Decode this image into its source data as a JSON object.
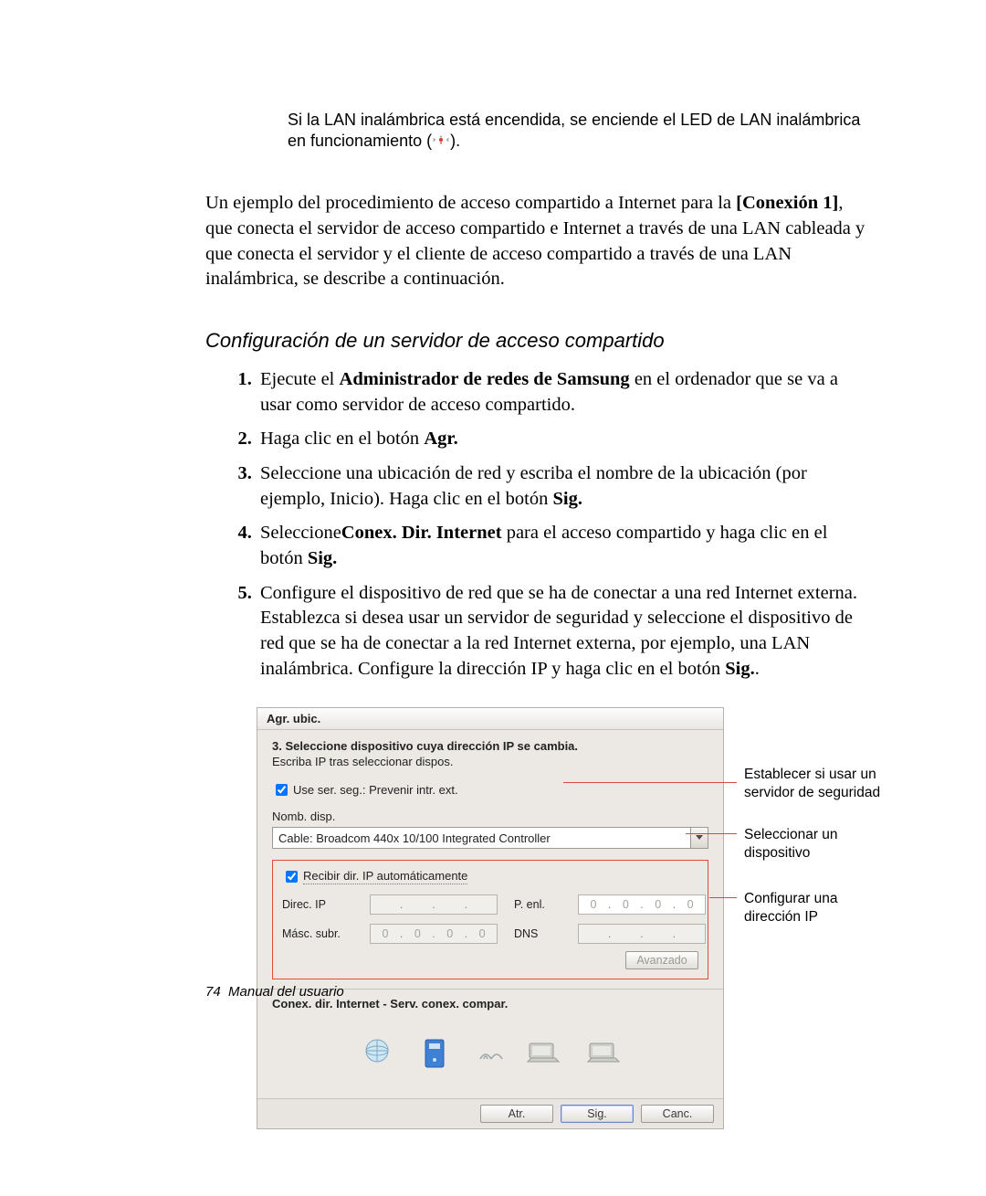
{
  "note": {
    "line1": "Si la LAN inalámbrica está encendida, se enciende el LED de LAN inalámbrica",
    "line2_a": "en funcionamiento (",
    "line2_b": ")."
  },
  "intro": {
    "p1_a": "Un ejemplo del procedimiento de acceso compartido a Internet para la ",
    "p1_b": "[Conexión 1]",
    "p1_c": ", que conecta el servidor de acceso compartido e Internet a través de una LAN cableada y que conecta el servidor y el cliente de acceso compartido a través de una LAN inalámbrica, se describe a continuación."
  },
  "subhead": "Configuración de un servidor de acceso compartido",
  "steps": {
    "s1_a": "Ejecute el ",
    "s1_b": "Administrador de redes de Samsung",
    "s1_c": " en el ordenador que se va a usar como servidor de acceso compartido.",
    "s2_a": "Haga clic en el botón ",
    "s2_b": "Agr.",
    "s3_a": "Seleccione una ubicación de red y escriba el nombre de la ubicación (por ejemplo, Inicio). Haga clic en el botón ",
    "s3_b": "Sig.",
    "s4_a": "Seleccione",
    "s4_b": "Conex. Dir. Internet",
    "s4_c": " para el acceso compartido y haga clic en el botón ",
    "s4_d": "Sig.",
    "s5_a": "Configure el dispositivo de red que se ha de conectar a una red Internet externa. Establezca si desea usar un servidor de seguridad y seleccione el dispositivo de red que se ha de conectar a la red Internet externa, por ejemplo, una LAN inalámbrica. Configure la dirección IP y haga clic en el botón  ",
    "s5_b": "Sig.",
    "s5_c": "."
  },
  "dialog": {
    "title": "Agr. ubic.",
    "subtitle": "3. Seleccione dispositivo cuya dirección IP se cambia.",
    "hint": "Escriba IP tras seleccionar dispos.",
    "chk_security": "Use ser. seg.: Prevenir intr. ext.",
    "device_label": "Nomb. disp.",
    "device_value": "Cable: Broadcom 440x 10/100 Integrated Controller",
    "chk_auto_ip": "Recibir dir. IP automáticamente",
    "lbl_ip": "Direc. IP",
    "lbl_mask": "Másc. subr.",
    "lbl_gw": "P. enl.",
    "lbl_dns": "DNS",
    "ip_gw": [
      "0",
      "0",
      "0",
      "0"
    ],
    "ip_mask": [
      "0",
      "0",
      "0",
      "0"
    ],
    "btn_advanced": "Avanzado",
    "conn_label": "Conex. dir. Internet - Serv. conex. compar.",
    "btn_back": "Atr.",
    "btn_next": "Sig.",
    "btn_cancel": "Canc."
  },
  "callouts": {
    "c1": "Establecer si usar un servidor de seguridad",
    "c2": "Seleccionar un dispositivo",
    "c3": "Configurar una dirección IP"
  },
  "footer": {
    "page": "74",
    "label": "Manual del usuario"
  }
}
